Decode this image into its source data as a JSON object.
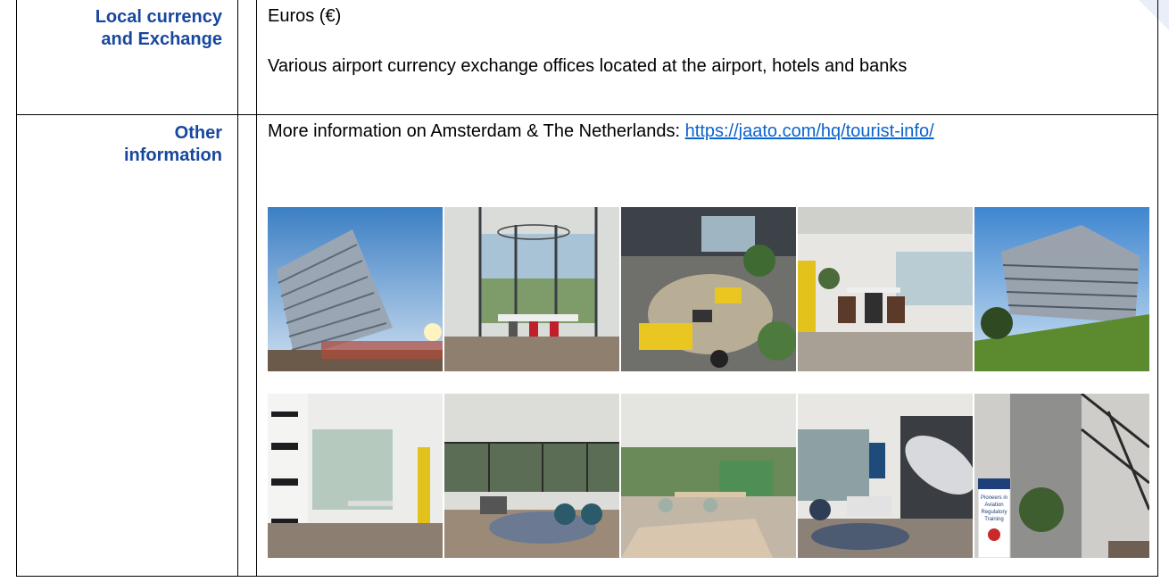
{
  "rows": [
    {
      "label_line1": "Local currency",
      "label_line2": "and Exchange",
      "currency": "Euros (€)",
      "exchange_text": "Various airport currency exchange offices located at the airport, hotels and banks"
    },
    {
      "label_line1": "Other",
      "label_line2": "information",
      "info_text": "More information on Amsterdam & The Netherlands: ",
      "link_text": "https://jaato.com/hq/tourist-info/"
    }
  ],
  "photos": [
    {
      "name": "building-exterior-sky-photo"
    },
    {
      "name": "glass-meeting-room-photo"
    },
    {
      "name": "lobby-yellow-seating-photo"
    },
    {
      "name": "lounge-high-chairs-photo"
    },
    {
      "name": "building-exterior-lawn-photo"
    },
    {
      "name": "corridor-glass-wall-photo"
    },
    {
      "name": "open-lounge-photo"
    },
    {
      "name": "canteen-tables-photo"
    },
    {
      "name": "lounge-aircraft-mural-photo"
    },
    {
      "name": "atrium-banner-photo",
      "banner_text": "Pioneers in Aviation Regulatory Training"
    }
  ],
  "colors": {
    "label": "#17479e",
    "link": "#0b63ce"
  }
}
